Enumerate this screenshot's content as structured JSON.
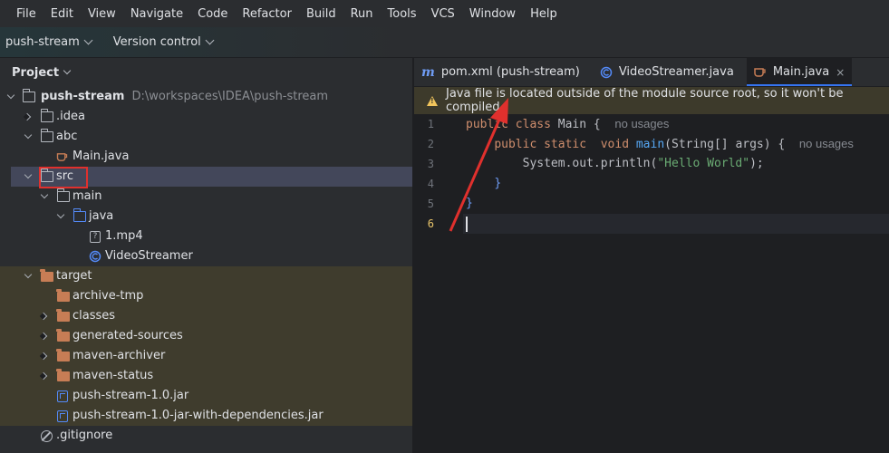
{
  "menu": [
    "File",
    "Edit",
    "View",
    "Navigate",
    "Code",
    "Refactor",
    "Build",
    "Run",
    "Tools",
    "VCS",
    "Window",
    "Help"
  ],
  "toolbar": {
    "project_name": "push-stream",
    "vcs_label": "Version control"
  },
  "project_panel": {
    "title": "Project"
  },
  "tree": [
    {
      "label": "push-stream",
      "extra": "D:\\workspaces\\IDEA\\push-stream"
    },
    {
      "label": ".idea"
    },
    {
      "label": "abc"
    },
    {
      "label": "Main.java"
    },
    {
      "label": "src"
    },
    {
      "label": "main"
    },
    {
      "label": "java"
    },
    {
      "label": "1.mp4"
    },
    {
      "label": "VideoStreamer"
    },
    {
      "label": "target"
    },
    {
      "label": "archive-tmp"
    },
    {
      "label": "classes"
    },
    {
      "label": "generated-sources"
    },
    {
      "label": "maven-archiver"
    },
    {
      "label": "maven-status"
    },
    {
      "label": "push-stream-1.0.jar"
    },
    {
      "label": "push-stream-1.0-jar-with-dependencies.jar"
    },
    {
      "label": ".gitignore"
    }
  ],
  "tabs": [
    {
      "icon": "m",
      "label": "pom.xml (push-stream)"
    },
    {
      "label": "VideoStreamer.java"
    },
    {
      "label": "Main.java",
      "close": "×"
    }
  ],
  "warning": "Java file is located outside of the module source root, so it won't be compiled",
  "editor": {
    "line_numbers": [
      "1",
      "2",
      "3",
      "4",
      "5",
      "6"
    ],
    "line1": {
      "kw": "public class ",
      "name": "Main ",
      "brace": "{",
      "hint": "no usages"
    },
    "line2": {
      "kw": "public static  void ",
      "fn": "main",
      "args": "(String[] args) ",
      "brace": "{",
      "hint": "no usages"
    },
    "line3": {
      "pre": "System.out.println(",
      "str": "\"Hello World\"",
      "post": ");"
    },
    "line4": "}",
    "line5": "}"
  },
  "colors": {
    "accent": "#3574f0",
    "annotation": "#e0302d",
    "warning_bg": "#3d3a2b",
    "excluded_bg": "#3f3c2d",
    "selected_bg": "#43475a"
  }
}
